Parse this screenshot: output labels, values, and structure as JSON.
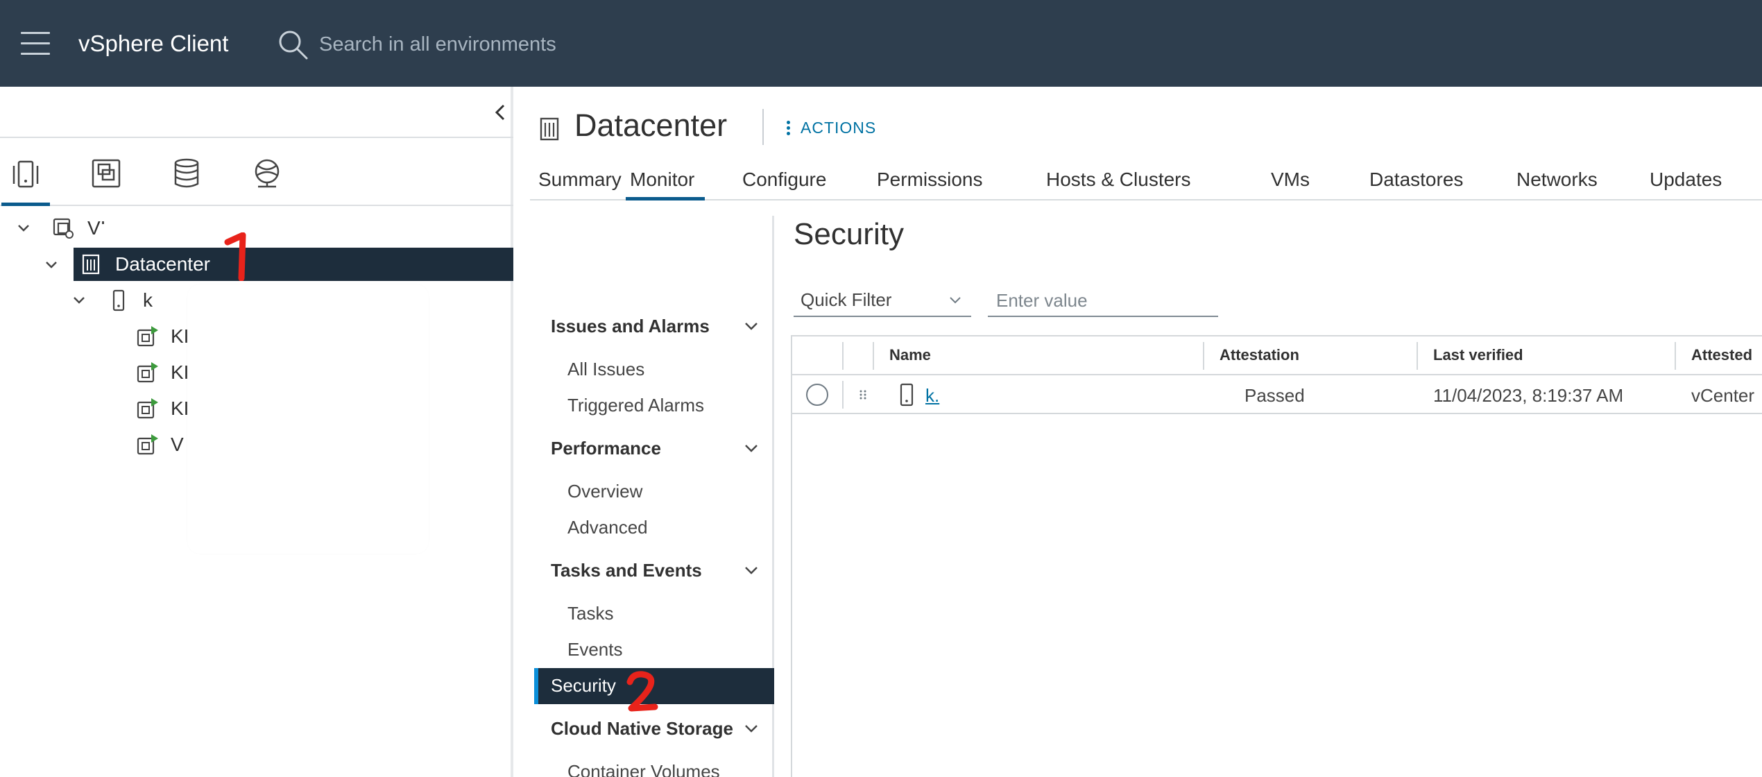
{
  "header": {
    "app_title": "vSphere Client",
    "search_placeholder": "Search in all environments"
  },
  "tree": {
    "root_label": "VI",
    "datacenter_label": "Datacenter",
    "host_label": "k",
    "vms": [
      {
        "label": "KI"
      },
      {
        "label": "KI"
      },
      {
        "label": "KI"
      },
      {
        "label": "V"
      }
    ]
  },
  "page": {
    "title": "Datacenter",
    "actions_label": "ACTIONS"
  },
  "tabs": [
    {
      "label": "Summary"
    },
    {
      "label": "Monitor"
    },
    {
      "label": "Configure"
    },
    {
      "label": "Permissions"
    },
    {
      "label": "Hosts & Clusters"
    },
    {
      "label": "VMs"
    },
    {
      "label": "Datastores"
    },
    {
      "label": "Networks"
    },
    {
      "label": "Updates"
    }
  ],
  "subnav": {
    "groups": [
      {
        "label": "Issues and Alarms",
        "items": [
          "All Issues",
          "Triggered Alarms"
        ]
      },
      {
        "label": "Performance",
        "items": [
          "Overview",
          "Advanced"
        ]
      },
      {
        "label": "Tasks and Events",
        "items": [
          "Tasks",
          "Events"
        ]
      },
      {
        "label": "Cloud Native Storage",
        "items": [
          "Container Volumes"
        ]
      }
    ],
    "selected": "Security"
  },
  "security": {
    "title": "Security",
    "quick_filter": "Quick Filter",
    "filter_placeholder": "Enter value",
    "columns": [
      "Name",
      "Attestation",
      "Last verified",
      "Attested"
    ],
    "rows": [
      {
        "name": "k.",
        "attestation": "Passed",
        "last_verified": "11/04/2023, 8:19:37 AM",
        "attested": "vCenter"
      }
    ]
  },
  "annotations": [
    "1",
    "2"
  ],
  "colors": {
    "header_bg": "#2e3e4e",
    "selected_bg": "#1d2d3c",
    "accent": "#0072a3",
    "annotation": "#e8231b"
  }
}
